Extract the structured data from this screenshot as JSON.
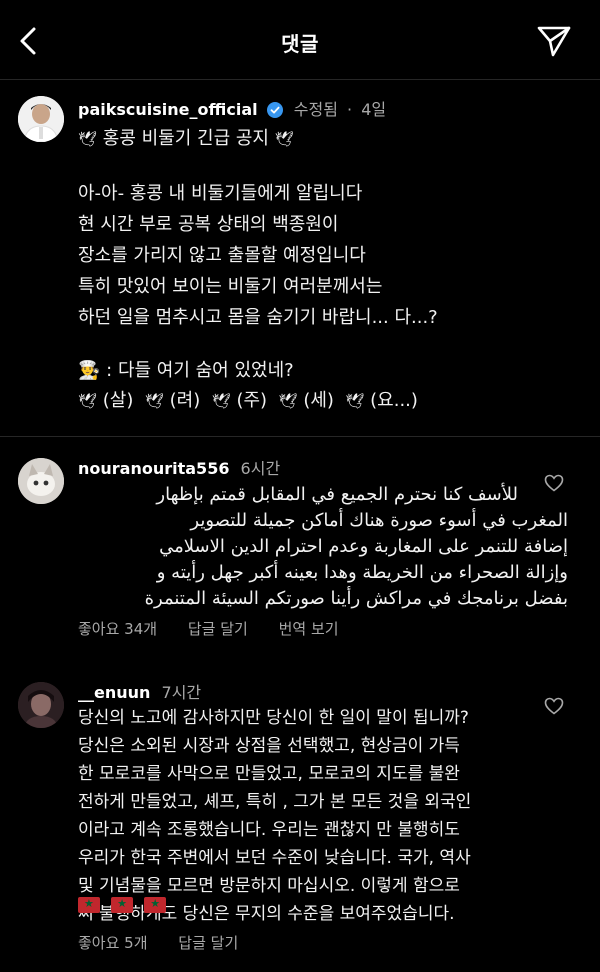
{
  "header": {
    "title": "댓글"
  },
  "post": {
    "username": "paikscuisine_official",
    "edited": "수정됨",
    "sep": "·",
    "time": "4일",
    "title_line": "홍콩 비둘기 긴급 공지",
    "body_lines": [
      "아-아- 홍콩 내 비둘기들에게 알립니다",
      "현 시간 부로 공복 상태의 백종원이",
      "장소를 가리지 않고 출몰할 예정입니다",
      "특히 맛있어 보이는 비둘기 여러분께서는",
      "하던 일을 멈추시고 몸을 숨기기 바랍니... 다...?"
    ],
    "speech_line": ": 다들 여기 숨어 있었네?",
    "dove_syllables": [
      "(살)",
      "(려)",
      "(주)",
      "(세)",
      "(요...)"
    ]
  },
  "comments": [
    {
      "username": "nouranourita556",
      "time": "6시간",
      "lines": [
        "للأسف كنا نحترم الجميع في المقابل قمتم بإظهار",
        "المغرب في أسوء صورة هناك أماكن جميلة للتصوير",
        "إضافة للتنمر على المغاربة وعدم احترام الدين الاسلامي",
        "وإزالة الصحراء من الخريطة وهدا بعينه أكبر جهل رأيته و",
        "بفضل برنامجك في مراكش رأينا صورتكم السيئة المتنمرة"
      ],
      "likes": "좋아요 34개",
      "reply": "답글 달기",
      "translate": "번역 보기"
    },
    {
      "username": "__enuun",
      "time": "7시간",
      "lines": [
        "당신의 노고에 감사하지만 당신이 한 일이 말이 됩니까?",
        "당신은 소외된 시장과 상점을 선택했고, 현상금이 가득",
        "한 모로코를 사막으로 만들었고, 모로코의 지도를 불완",
        "전하게 만들었고, 셰프, 특히 , 그가 본 모든 것을 외국인",
        "이라고 계속 조롱했습니다. 우리는 괜찮지 만 불행히도",
        "우리가 한국 주변에서 보던 수준이 낮습니다. 국가, 역사",
        "및 기념물을 모르면 방문하지 마십시오. 이렇게 함으로",
        "써 불행하게도 당신은 무지의 수준을 보여주었습니다."
      ],
      "likes": "좋아요 5개",
      "reply": "답글 달기"
    }
  ],
  "colors": {
    "background": "#000000",
    "muted": "#a8a8a8",
    "verified": "#3897f0",
    "divider": "#262626"
  },
  "icons": [
    "back-icon",
    "send-icon",
    "verified-badge-icon",
    "dove-icon",
    "heart-icon",
    "morocco-flag-icon"
  ]
}
